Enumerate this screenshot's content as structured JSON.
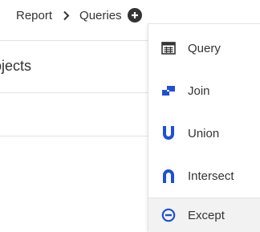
{
  "breadcrumb": {
    "items": [
      "Report",
      "Queries"
    ],
    "separator_icon": "chevron-right-icon",
    "add_icon": "plus-circle-icon"
  },
  "background": {
    "title_fragment": "ɔjects"
  },
  "dropdown": {
    "items": [
      {
        "label": "Query",
        "icon": "table-icon"
      },
      {
        "label": "Join",
        "icon": "join-icon"
      },
      {
        "label": "Union",
        "icon": "union-icon"
      },
      {
        "label": "Intersect",
        "icon": "intersect-icon"
      },
      {
        "label": "Except",
        "icon": "minus-circle-icon"
      }
    ],
    "hovered_item": "Except"
  },
  "colors": {
    "union_blue": "#1f4fd6",
    "text": "#333333",
    "hover_bg": "#f2f2f2"
  }
}
